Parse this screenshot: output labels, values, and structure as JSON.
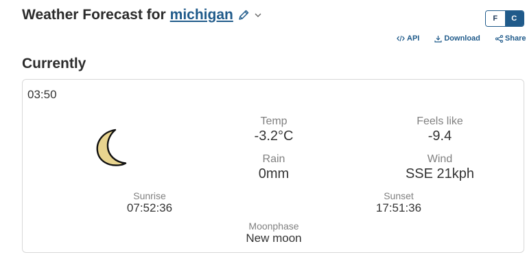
{
  "header": {
    "title_prefix": "Weather Forecast for",
    "location": "michigan"
  },
  "units": {
    "f_label": "F",
    "c_label": "C",
    "selected": "C"
  },
  "actions": {
    "api_label": "API",
    "download_label": "Download",
    "share_label": "Share"
  },
  "current": {
    "heading": "Currently",
    "time": "03:50",
    "icon": "crescent-moon-icon",
    "temp_label": "Temp",
    "temp_value": "-3.2°C",
    "feels_label": "Feels like",
    "feels_value": "-9.4",
    "rain_label": "Rain",
    "rain_value": "0mm",
    "wind_label": "Wind",
    "wind_value": "SSE 21kph",
    "sunrise_label": "Sunrise",
    "sunrise_value": "07:52:36",
    "sunset_label": "Sunset",
    "sunset_value": "17:51:36",
    "moonphase_label": "Moonphase",
    "moonphase_value": "New moon"
  },
  "colors": {
    "accent": "#1f5a8a",
    "moon_fill": "#e8d48f"
  }
}
